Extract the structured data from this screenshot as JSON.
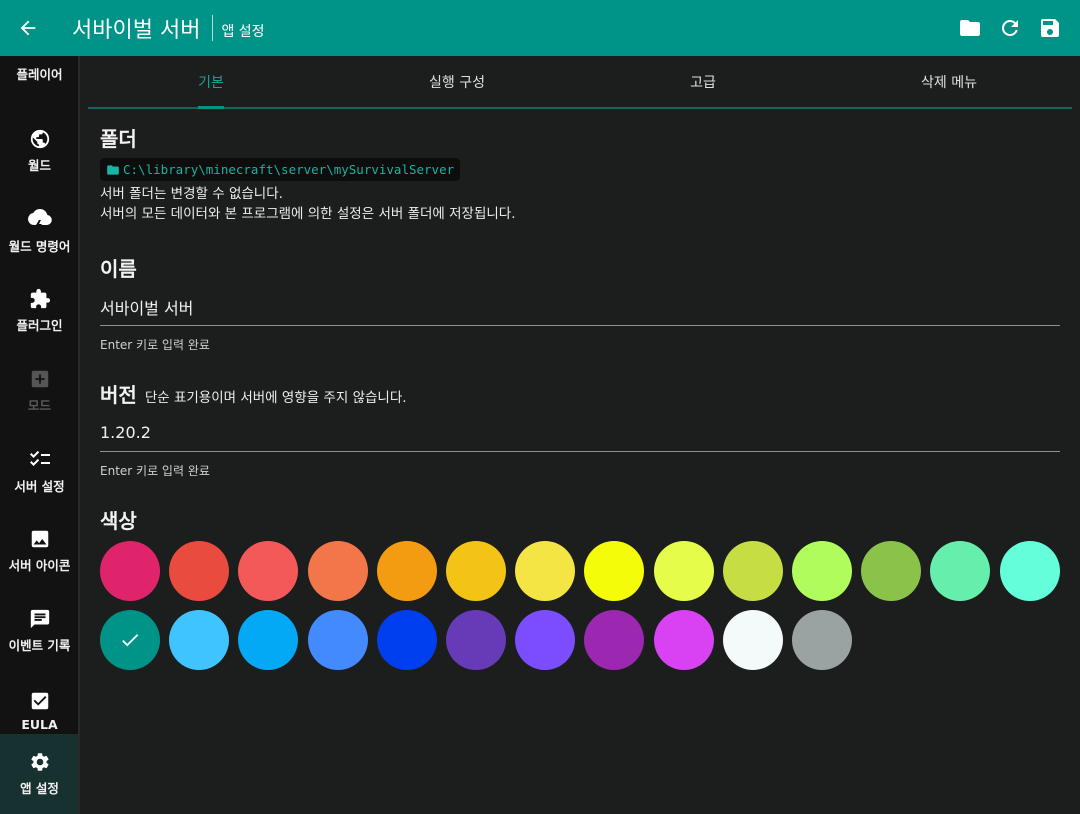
{
  "header": {
    "title": "서바이벌 서버",
    "subtitle": "앱 설정",
    "icons": [
      "back-arrow-icon",
      "folder-icon",
      "refresh-icon",
      "save-icon"
    ],
    "accent": "#009488"
  },
  "sidebar": {
    "items": [
      {
        "label": "플레이어",
        "icon": "player-icon"
      },
      {
        "label": "월드",
        "icon": "globe-icon"
      },
      {
        "label": "월드 명령어",
        "icon": "storm-cloud-icon"
      },
      {
        "label": "플러그인",
        "icon": "puzzle-icon"
      },
      {
        "label": "모드",
        "icon": "add-box-icon",
        "disabled": true
      },
      {
        "label": "서버 설정",
        "icon": "checklist-icon"
      },
      {
        "label": "서버 아이콘",
        "icon": "image-icon"
      },
      {
        "label": "이벤트 기록",
        "icon": "message-icon"
      },
      {
        "label": "EULA",
        "icon": "checkbox-icon"
      },
      {
        "label": "앱 설정",
        "icon": "gear-icon",
        "active": true
      }
    ]
  },
  "tabs": [
    "기본",
    "실행 구성",
    "고급",
    "삭제 메뉴"
  ],
  "active_tab": "기본",
  "folder": {
    "heading": "폴더",
    "path": "C:\\library\\minecraft\\server\\mySurvivalServer",
    "line1": "서버 폴더는 변경할 수 없습니다.",
    "line2": "서버의 모든 데이터와 본 프로그램에 의한 설정은 서버 폴더에 저장됩니다."
  },
  "name": {
    "heading": "이름",
    "value": "서바이벌 서버",
    "help": "Enter 키로 입력 완료"
  },
  "version": {
    "heading": "버전",
    "note": "단순 표기용이며 서버에 영향을 주지 않습니다.",
    "value": "1.20.2",
    "help": "Enter 키로 입력 완료"
  },
  "color": {
    "heading": "색상",
    "selected_index": 14,
    "swatches": [
      "#e0246b",
      "#e94b3f",
      "#f45959",
      "#f27649",
      "#f39c12",
      "#f3c316",
      "#f4e444",
      "#f4fc0a",
      "#e5fc4a",
      "#c6de43",
      "#b0fc5c",
      "#8bc34a",
      "#66eeac",
      "#64ffda",
      "#009488",
      "#40c4ff",
      "#03a9f4",
      "#448aff",
      "#003ff0",
      "#673ab7",
      "#7c4dff",
      "#9c27b0",
      "#d942f2",
      "#f4fafa",
      "#9aa2a2"
    ]
  }
}
